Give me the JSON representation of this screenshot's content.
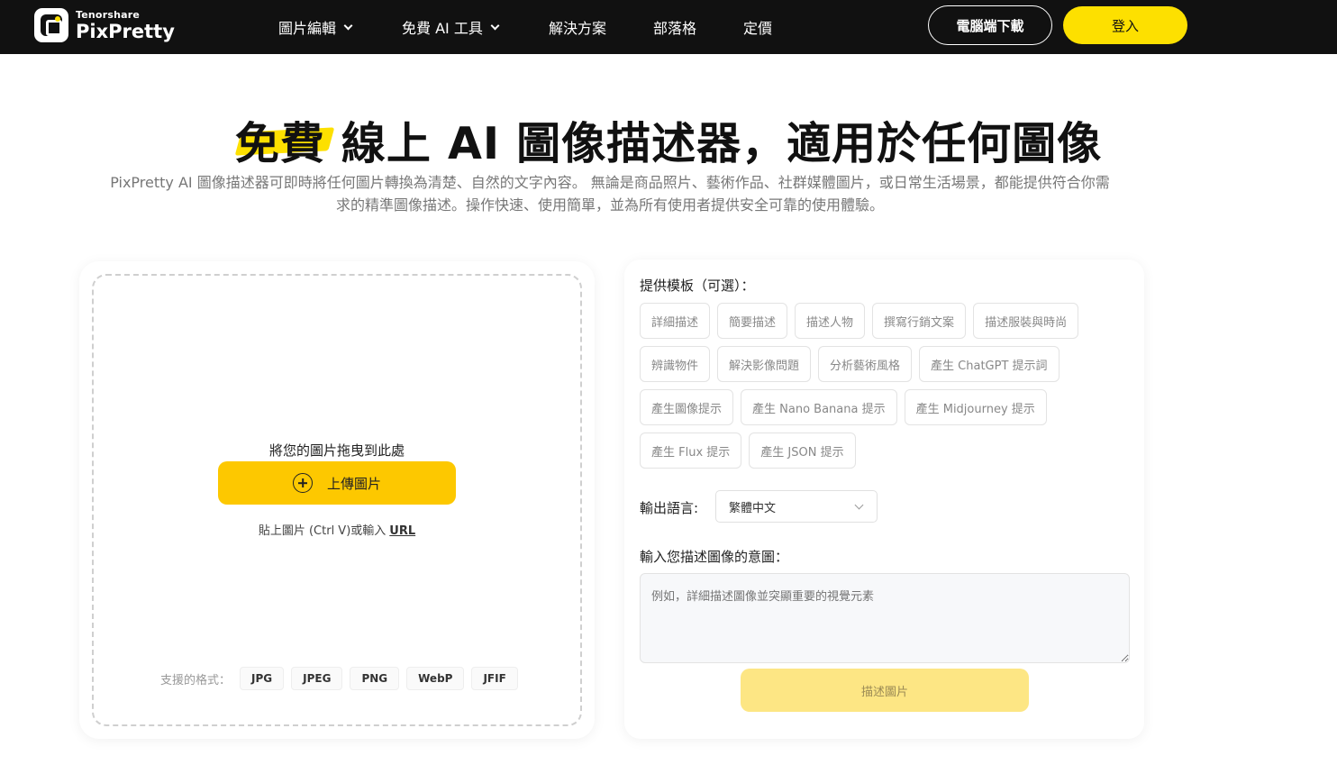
{
  "header": {
    "brand": "Tenorshare",
    "product": "PixPretty",
    "nav": [
      {
        "label": "圖片編輯",
        "dropdown": true
      },
      {
        "label": "免費 AI 工具",
        "dropdown": true
      },
      {
        "label": "解決方案",
        "dropdown": false
      },
      {
        "label": "部落格",
        "dropdown": false
      },
      {
        "label": "定價",
        "dropdown": false
      }
    ],
    "download_label": "電腦端下載",
    "login_label": "登入"
  },
  "hero": {
    "title_highlight": "免費",
    "title_rest": " 線上 AI 圖像描述器，適用於任何圖像",
    "desc_line1": "PixPretty AI 圖像描述器可即時將任何圖片轉換為清楚、自然的文字內容。 無論是商品照片、藝術作品、社群媒體圖片，或日常生活場景，都能提供符合你需",
    "desc_line2": "求的精準圖像描述。操作快速、使用簡單，並為所有使用者提供安全可靠的使用體驗。"
  },
  "upload": {
    "drop_text": "將您的圖片拖曳到此處",
    "upload_label": "上傳圖片",
    "paste_text": "貼上圖片 (Ctrl V)或輸入",
    "url_label": "URL",
    "formats_label": "支援的格式：",
    "formats": [
      "JPG",
      "JPEG",
      "PNG",
      "WebP",
      "JFIF"
    ]
  },
  "options": {
    "template_label": "提供模板（可選）：",
    "templates": [
      [
        "詳細描述",
        "簡要描述",
        "描述人物",
        "撰寫行銷文案",
        "描述服裝與時尚"
      ],
      [
        "辨識物件",
        "解決影像問題",
        "分析藝術風格",
        "產生 ChatGPT 提示詞"
      ],
      [
        "產生圖像提示",
        "產生 Nano Banana 提示",
        "產生 Midjourney 提示"
      ],
      [
        "產生 Flux 提示",
        "產生 JSON 提示"
      ]
    ],
    "language_label": "輸出語言:",
    "language_value": "繁體中文",
    "intent_label": "輸入您描述圖像的意圖：",
    "intent_placeholder": "例如，詳細描述圖像並突顯重要的視覺元素",
    "describe_label": "描述圖片"
  },
  "colors": {
    "accent": "#fde000",
    "upload_button": "#fdc800",
    "describe_disabled": "#fde684",
    "navbar": "#111111"
  }
}
